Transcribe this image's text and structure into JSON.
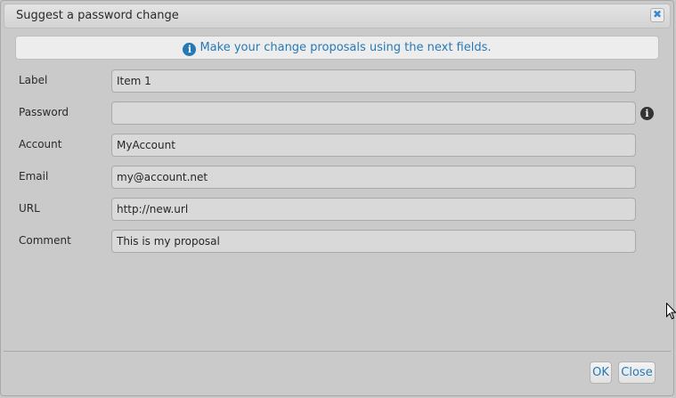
{
  "dialog": {
    "title": "Suggest a password change",
    "close_icon": "✖",
    "info_icon": "i",
    "info_message": "Make your change proposals using the next fields."
  },
  "form": {
    "label": {
      "label": "Label",
      "value": "Item 1"
    },
    "password": {
      "label": "Password",
      "value": "",
      "info_icon": "i"
    },
    "account": {
      "label": "Account",
      "value": "MyAccount"
    },
    "email": {
      "label": "Email",
      "value": "my@account.net"
    },
    "url": {
      "label": "URL",
      "value": "http://new.url"
    },
    "comment": {
      "label": "Comment",
      "value": "This is my proposal"
    }
  },
  "buttons": {
    "ok": "OK",
    "close": "Close"
  },
  "colors": {
    "accent": "#2779b6",
    "background": "#cacaca"
  }
}
